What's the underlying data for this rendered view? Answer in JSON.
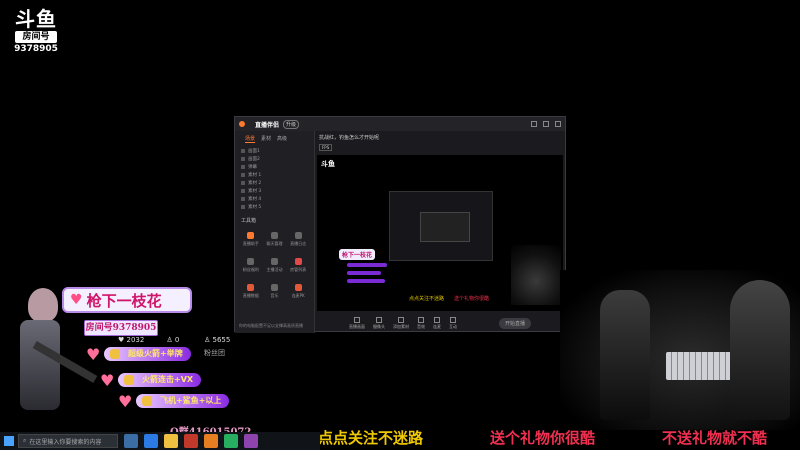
{
  "logo": {
    "brand": "斗鱼",
    "room_tag": "房间号",
    "room_number": "9378905"
  },
  "app_window": {
    "title": "直播伴侣",
    "badge": "升级",
    "side_tabs": [
      "场景",
      "素材",
      "高级"
    ],
    "scene_items": [
      "画面1",
      "画面2",
      "弹幕",
      "素材 1",
      "素材 2",
      "素材 3",
      "素材 4",
      "素材 5"
    ],
    "tools_title": "工具箱",
    "tools": [
      "直播助手",
      "聊天管理",
      "直播日志",
      "粉丝福利",
      "主播活动",
      "房管列表",
      "直播数据",
      "音乐",
      "连麦PK"
    ],
    "stream_title": "抗战红，钓鱼怎么才开始呢",
    "stream_tag": "FPS",
    "toolbar": [
      "直播画面",
      "摄像头",
      "添加素材",
      "音效",
      "连麦",
      "互动"
    ],
    "start_button": "开始直播",
    "footer": "你的电脑配置不足以支撑高画质直播"
  },
  "preview": {
    "mini_logo": "斗鱼",
    "mini_name": "枪下一枝花",
    "ticker_yellow": "点点关注不迷路",
    "ticker_red": "送个礼物你很酷"
  },
  "overlay": {
    "streamer_name": "枪下一枝花",
    "room_label": "房间号9378905",
    "stat_hot": "2032",
    "stat_fans": "0",
    "stat_right": "5655",
    "stat_right2": "粉丝团",
    "gifts": [
      "超级火箭+举牌",
      "火箭连击+VX",
      "飞机+鲨鱼+以上"
    ],
    "qq": "Q群416015072"
  },
  "tickers": [
    "点点关注不迷路",
    "送个礼物你很酷",
    "不送礼物就不酷"
  ],
  "taskbar": {
    "search_placeholder": "在这里输入你要搜索的内容"
  }
}
